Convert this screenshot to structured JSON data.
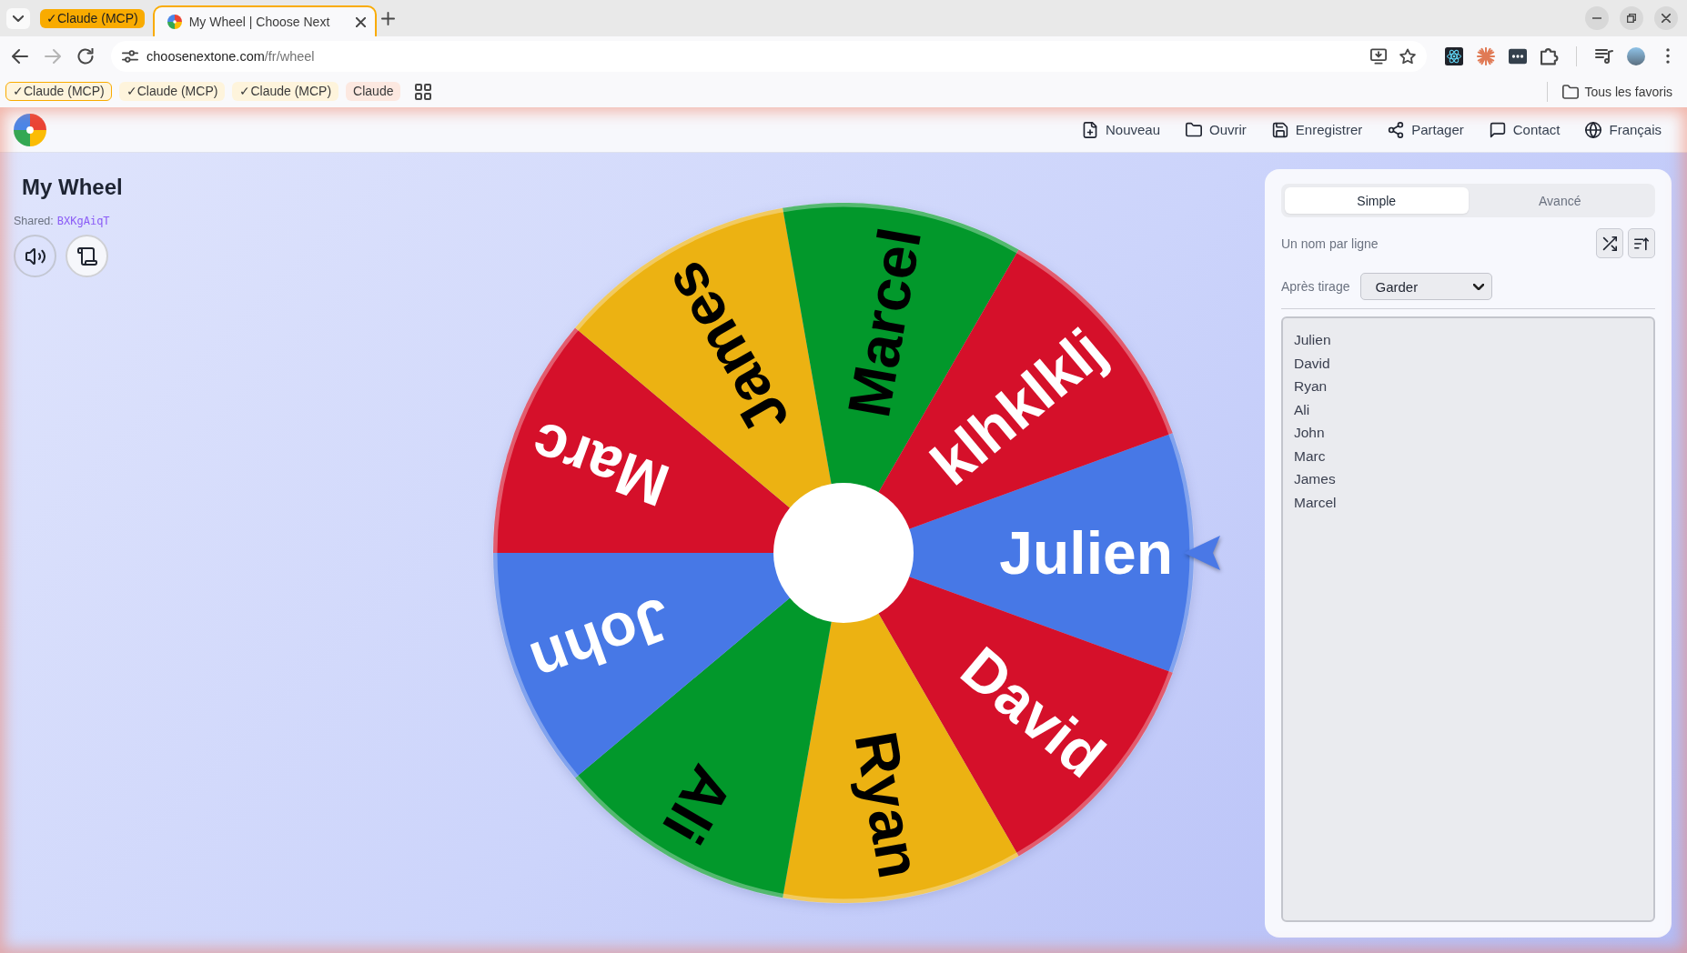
{
  "browser": {
    "tab_group": "✓Claude (MCP)",
    "tabs": [
      {
        "title": "My Wheel | Choose Next",
        "selected": true
      }
    ],
    "nav_buttons": [
      {
        "kind": "back",
        "disabled": false
      },
      {
        "kind": "forward",
        "disabled": true
      },
      {
        "kind": "reload",
        "disabled": false
      }
    ],
    "address": {
      "host": "choosenextone.com",
      "path": "/fr/wheel"
    },
    "bookmarks": [
      {
        "label": "✓Claude (MCP)",
        "selected": true,
        "color": "#fef4dc"
      },
      {
        "label": "✓Claude (MCP)",
        "selected": false,
        "color": "#fef4dc"
      },
      {
        "label": "✓Claude (MCP)",
        "selected": false,
        "color": "#fef4dc"
      },
      {
        "label": "Claude",
        "selected": false,
        "color": "#fce8e0"
      }
    ],
    "all_bookmarks": "Tous les favoris"
  },
  "header": {
    "nav": [
      {
        "kind": "new",
        "label": "Nouveau"
      },
      {
        "kind": "open",
        "label": "Ouvrir"
      },
      {
        "kind": "save",
        "label": "Enregistrer"
      },
      {
        "kind": "share",
        "label": "Partager"
      },
      {
        "kind": "contact",
        "label": "Contact"
      },
      {
        "kind": "language",
        "label": "Français"
      }
    ]
  },
  "sidebar": {
    "title": "My Wheel",
    "shared_label": "Shared:",
    "shared_code": "BXKgAiqT",
    "buttons": [
      {
        "kind": "sound",
        "active": false
      },
      {
        "kind": "history",
        "active": true
      }
    ]
  },
  "wheel": {
    "segments": [
      {
        "label": "Julien",
        "color": "#4778e6",
        "dark_label": false
      },
      {
        "label": "David",
        "color": "#d5102a",
        "dark_label": false
      },
      {
        "label": "Ryan",
        "color": "#ecb212",
        "dark_label": true
      },
      {
        "label": "Ali",
        "color": "#02982b",
        "dark_label": true
      },
      {
        "label": "John",
        "color": "#4778e6",
        "dark_label": false
      },
      {
        "label": "Marc",
        "color": "#d5102a",
        "dark_label": false
      },
      {
        "label": "James",
        "color": "#ecb212",
        "dark_label": true
      },
      {
        "label": "Marcel",
        "color": "#02982b",
        "dark_label": true
      },
      {
        "label": "klhklklj",
        "color": "#d5102a",
        "dark_label": false
      }
    ]
  },
  "panel": {
    "tabs": [
      {
        "label": "Simple",
        "selected": true
      },
      {
        "label": "Avancé",
        "selected": false
      }
    ],
    "hint": "Un nom par ligne",
    "list_tools": [
      {
        "kind": "shuffle"
      },
      {
        "kind": "sort"
      }
    ],
    "after_draw": {
      "label": "Après tirage",
      "value": "Garder"
    },
    "names": [
      "Julien",
      "David",
      "Ryan",
      "Ali",
      "John",
      "Marc",
      "James",
      "Marcel"
    ]
  }
}
